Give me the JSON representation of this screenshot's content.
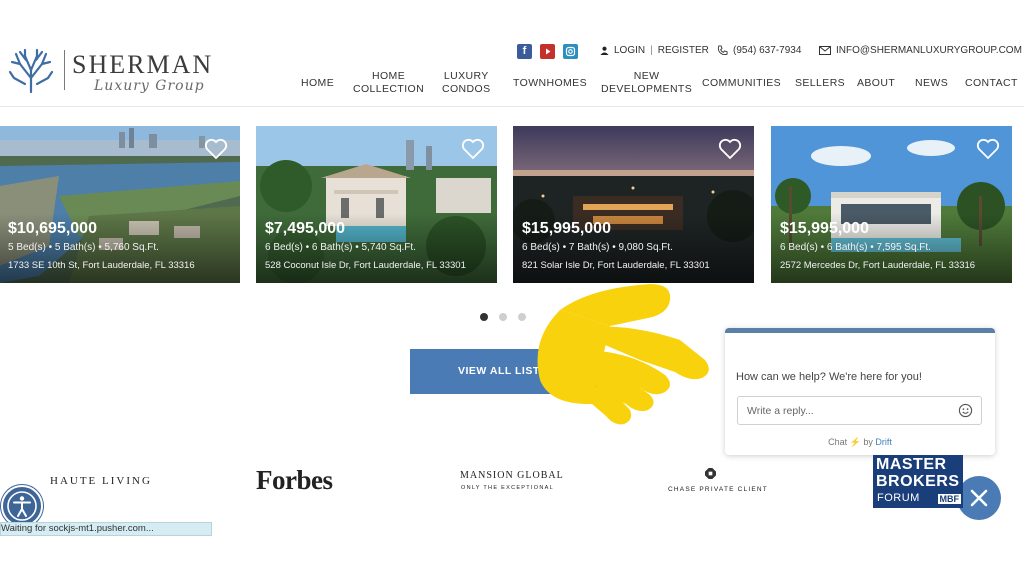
{
  "logo": {
    "word": "SHERMAN",
    "sub": "Luxury Group"
  },
  "utility": {
    "login": "LOGIN",
    "register": "REGISTER",
    "separator": "|",
    "phone": "(954) 637-7934",
    "email": "INFO@SHERMANLUXURYGROUP.COM"
  },
  "social": [
    "facebook-icon",
    "youtube-icon",
    "instagram-icon"
  ],
  "nav": {
    "home": "HOME",
    "home_collection_1": "HOME",
    "home_collection_2": "COLLECTION",
    "luxury_condos_1": "LUXURY",
    "luxury_condos_2": "CONDOS",
    "townhomes": "TOWNHOMES",
    "new_dev_1": "NEW",
    "new_dev_2": "DEVELOPMENTS",
    "communities": "COMMUNITIES",
    "sellers": "SELLERS",
    "about": "ABOUT",
    "news": "NEWS",
    "contact": "CONTACT"
  },
  "listings": [
    {
      "price": "$10,695,000",
      "details": "5 Bed(s) • 5 Bath(s) • 5,760 Sq.Ft.",
      "address": "1733 SE 10th St, Fort Lauderdale, FL 33316"
    },
    {
      "price": "$7,495,000",
      "details": "6 Bed(s) • 6 Bath(s) • 5,740 Sq.Ft.",
      "address": "528 Coconut Isle Dr, Fort Lauderdale, FL 33301"
    },
    {
      "price": "$15,995,000",
      "details": "6 Bed(s) • 7 Bath(s) • 9,080 Sq.Ft.",
      "address": "821 Solar Isle Dr, Fort Lauderdale, FL 33301"
    },
    {
      "price": "$15,995,000",
      "details": "6 Bed(s) • 6 Bath(s) • 7,595 Sq.Ft.",
      "address": "2572 Mercedes Dr, Fort Lauderdale, FL 33316"
    }
  ],
  "carousel": {
    "pages": 3,
    "active": 1
  },
  "view_all": "VIEW ALL LISTINGS",
  "chat": {
    "prompt": "How can we help? We're here for you!",
    "placeholder": "Write a reply...",
    "footer_prefix": "Chat",
    "footer_by": "by",
    "footer_brand": "Drift"
  },
  "press": {
    "haute": "HAUTE LIVING",
    "forbes": "Forbes",
    "mansion": "MANSION GLOBAL",
    "mansion_sub": "ONLY THE EXCEPTIONAL",
    "chase": "CHASE PRIVATE CLIENT",
    "mbf_1": "MASTER",
    "mbf_2": "BROKERS",
    "mbf_3": "FORUM",
    "mbf_4": "MBF"
  },
  "status_bar": "Waiting for sockjs-mt1.pusher.com...",
  "colors": {
    "accent": "#4a7bb5",
    "chat_bar": "#5b7fa8",
    "hand": "#f9d20e",
    "mbf": "#1a3e7a"
  }
}
